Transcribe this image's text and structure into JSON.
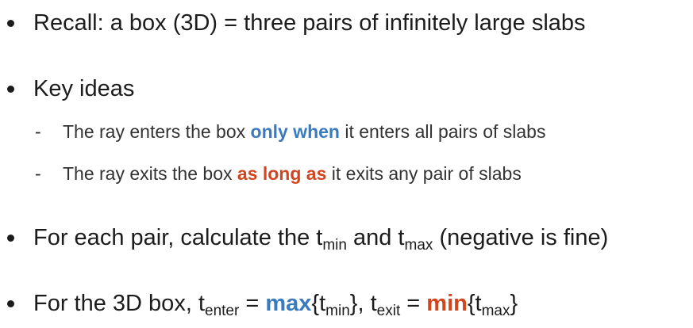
{
  "bullets": {
    "recall": "Recall: a box (3D) = three pairs of infinitely large slabs",
    "key_ideas": "Key ideas",
    "pair_prefix": "For each pair, calculate the t",
    "pair_min_sub": "min",
    "pair_mid": " and t",
    "pair_max_sub": "max",
    "pair_suffix": " (negative is fine)",
    "box_prefix": "For the 3D box, t",
    "box_enter_sub": "enter",
    "box_eq1": " = ",
    "box_max": "max",
    "box_brace_open1": "{t",
    "box_min_sub": "min",
    "box_brace_close1": "}, t",
    "box_exit_sub": "exit",
    "box_eq2": " = ",
    "box_min": "min",
    "box_brace_open2": "{t",
    "box_max_sub": "max",
    "box_brace_close2": "}"
  },
  "subbullets": {
    "dash": "-",
    "enters_prefix": "The ray enters the box ",
    "enters_highlight": "only when",
    "enters_suffix": " it enters all pairs of slabs",
    "exits_prefix": "The ray exits the box ",
    "exits_highlight": "as long as",
    "exits_suffix": " it exits any pair of slabs"
  },
  "colors": {
    "text": "#1c1c1c",
    "blue_highlight": "#3a7bbf",
    "red_highlight": "#d2451f"
  }
}
